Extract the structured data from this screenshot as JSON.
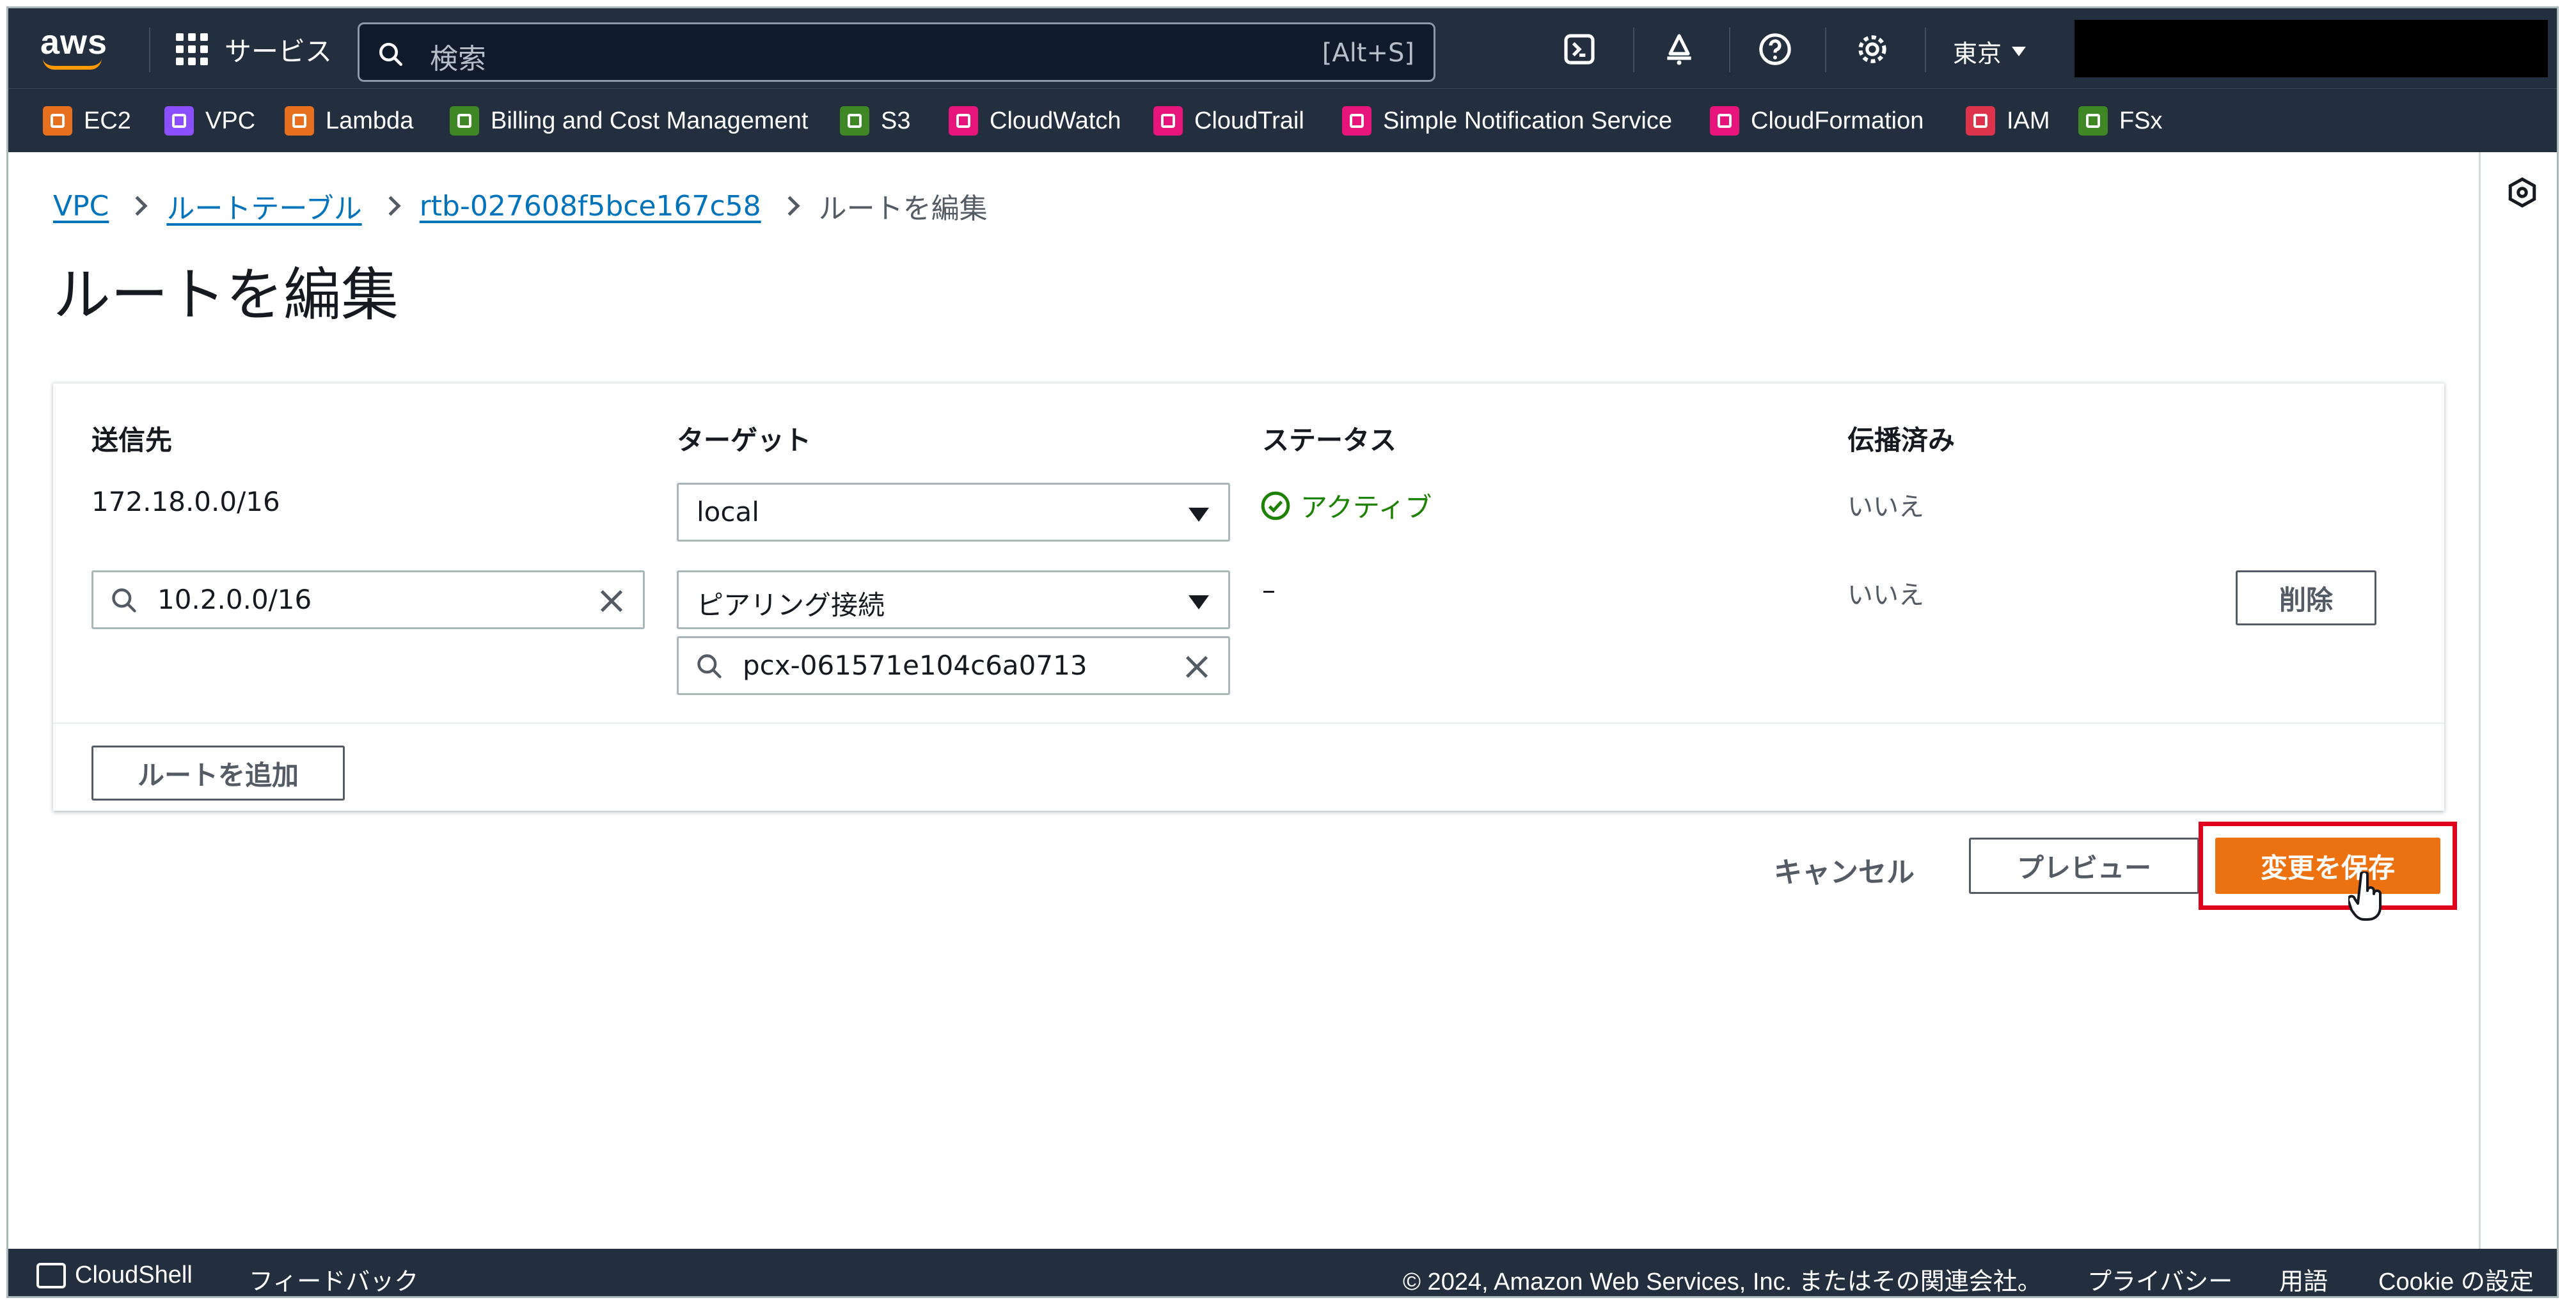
{
  "topnav": {
    "logo_text": "aws",
    "services_label": "サービス",
    "search_placeholder": "検索",
    "search_shortcut": "[Alt+S]",
    "region": "東京"
  },
  "favorites": [
    {
      "label": "EC2",
      "color": "#e7701e"
    },
    {
      "label": "VPC",
      "color": "#8c4fff"
    },
    {
      "label": "Lambda",
      "color": "#e7701e"
    },
    {
      "label": "Billing and Cost Management",
      "color": "#3f8624"
    },
    {
      "label": "S3",
      "color": "#3f8624"
    },
    {
      "label": "CloudWatch",
      "color": "#e7157b"
    },
    {
      "label": "CloudTrail",
      "color": "#e7157b"
    },
    {
      "label": "Simple Notification Service",
      "color": "#e7157b"
    },
    {
      "label": "CloudFormation",
      "color": "#e7157b"
    },
    {
      "label": "IAM",
      "color": "#dd344c"
    },
    {
      "label": "FSx",
      "color": "#3f8624"
    }
  ],
  "breadcrumb": {
    "items": [
      "VPC",
      "ルートテーブル",
      "rtb-027608f5bce167c58"
    ],
    "current": "ルートを編集"
  },
  "page_title": "ルートを編集",
  "routes_table": {
    "headers": {
      "destination": "送信先",
      "target": "ターゲット",
      "status": "ステータス",
      "propagated": "伝播済み"
    },
    "rows": [
      {
        "destination": "172.18.0.0/16",
        "target": "local",
        "status": "アクティブ",
        "propagated": "いいえ"
      },
      {
        "destination": "10.2.0.0/16",
        "target": "ピアリング接続",
        "target_id": "pcx-061571e104c6a0713",
        "status": "–",
        "propagated": "いいえ",
        "remove_label": "削除"
      }
    ],
    "add_route_label": "ルートを追加"
  },
  "actions": {
    "cancel": "キャンセル",
    "preview": "プレビュー",
    "save": "変更を保存"
  },
  "footer": {
    "cloudshell": "CloudShell",
    "feedback": "フィードバック",
    "copyright": "© 2024, Amazon Web Services, Inc. またはその関連会社。",
    "privacy": "プライバシー",
    "terms": "用語",
    "cookie": "Cookie の設定"
  },
  "colors": {
    "nav_bg": "#232f3e",
    "link": "#0073bb",
    "primary": "#ec7211",
    "success": "#1d8102",
    "highlight": "#e0001b"
  }
}
